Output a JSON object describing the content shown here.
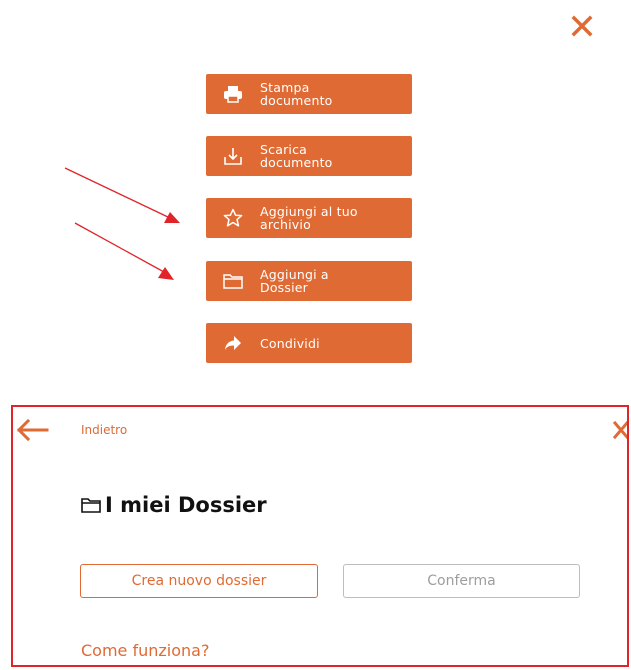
{
  "menu": {
    "close_icon": "close-icon",
    "accent_color": "#e06a33",
    "items": [
      {
        "label": "Stampa\ndocumento",
        "icon": "printer-icon"
      },
      {
        "label": "Scarica\ndocumento",
        "icon": "download-icon"
      },
      {
        "label": "Aggiungi al tuo\narchivio",
        "icon": "star-icon"
      },
      {
        "label": "Aggiungi a\nDossier",
        "icon": "folder-icon"
      },
      {
        "label": "Condividi",
        "icon": "share-arrow-icon"
      }
    ]
  },
  "annotation": {
    "color": "#e1242a"
  },
  "dossier_panel": {
    "back_label": "Indietro",
    "title": "I miei Dossier",
    "title_icon": "folder-icon",
    "create_button": "Crea nuovo dossier",
    "confirm_button": "Conferma",
    "help_link": "Come funziona?",
    "border_color": "#e1242a"
  }
}
